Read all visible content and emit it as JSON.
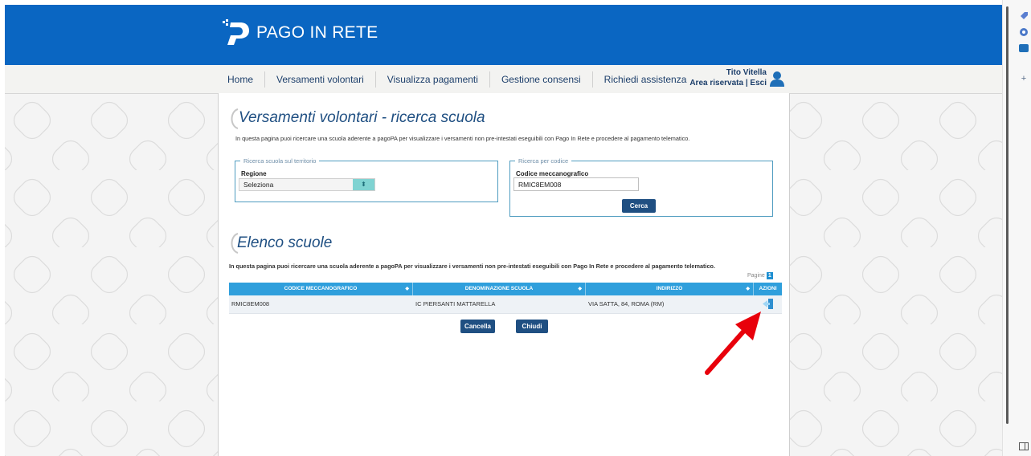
{
  "header": {
    "logo_text": "PAGO IN RETE"
  },
  "nav": {
    "items": [
      "Home",
      "Versamenti volontari",
      "Visualizza pagamenti",
      "Gestione consensi",
      "Richiedi assistenza"
    ]
  },
  "user": {
    "name": "Tito Vitella",
    "area": "Area riservata",
    "separator": "|",
    "logout": "Esci"
  },
  "search_section": {
    "title": "Versamenti volontari - ricerca scuola",
    "description": "In questa pagina puoi ricercare una scuola aderente a pagoPA per visualizzare i versamenti non pre-intestati eseguibili con Pago In Rete e procedere al pagamento telematico.",
    "territory_box": {
      "legend": "Ricerca scuola sul territorio",
      "region_label": "Regione",
      "region_value": "Seleziona"
    },
    "code_box": {
      "legend": "Ricerca per codice",
      "code_label": "Codice meccanografico",
      "code_value": "RMIC8EM008",
      "search_button": "Cerca"
    }
  },
  "results_section": {
    "title": "Elenco scuole",
    "description": "In questa pagina puoi ricercare una scuola aderente a pagoPA per visualizzare i versamenti non pre-intestati eseguibili con Pago In Rete e procedere al pagamento telematico.",
    "pager_label": "Pagine",
    "pager_page": "1",
    "columns": [
      "CODICE MECCANOGRAFICO",
      "DENOMINAZIONE SCUOLA",
      "INDIRIZZO",
      "AZIONI"
    ],
    "rows": [
      {
        "code": "RMIC8EM008",
        "name": "IC PIERSANTI MATTARELLA",
        "address": "VIA SATTA, 84, ROMA (RM)",
        "action_icon": "select-school-icon"
      }
    ],
    "cancel_button": "Cancella",
    "close_button": "Chiudi"
  },
  "annotation": {
    "arrow_color": "#e8000b"
  },
  "colors": {
    "brand_blue": "#0a66c2",
    "table_header": "#2f9fdc",
    "title_blue": "#1f4f82"
  }
}
